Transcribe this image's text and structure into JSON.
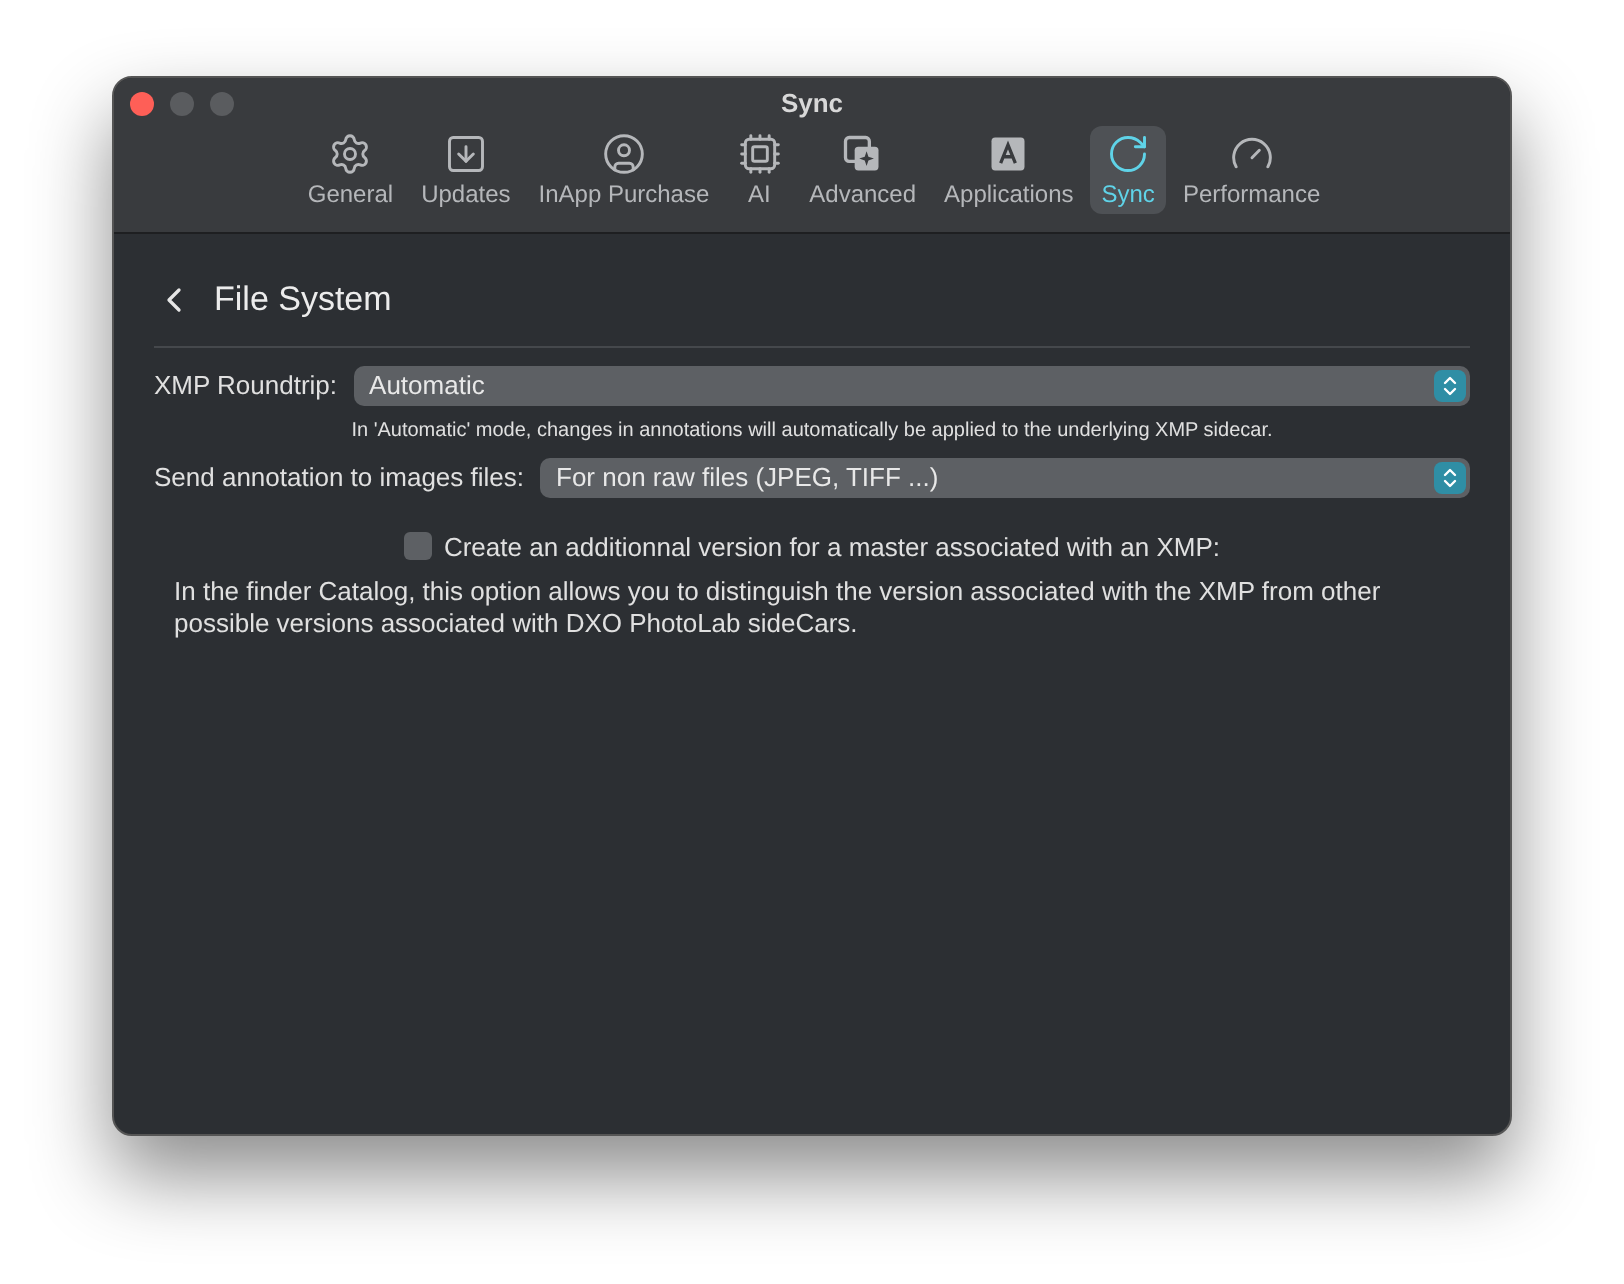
{
  "window": {
    "title": "Sync"
  },
  "tabs": [
    {
      "label": "General",
      "kind": "gear",
      "selected": false
    },
    {
      "label": "Updates",
      "kind": "download",
      "selected": false
    },
    {
      "label": "InApp Purchase",
      "kind": "user",
      "selected": false
    },
    {
      "label": "AI",
      "kind": "chip",
      "selected": false
    },
    {
      "label": "Advanced",
      "kind": "sparkle",
      "selected": false
    },
    {
      "label": "Applications",
      "kind": "letter",
      "selected": false
    },
    {
      "label": "Sync",
      "kind": "sync",
      "selected": true
    },
    {
      "label": "Performance",
      "kind": "gauge",
      "selected": false
    }
  ],
  "header": {
    "title": "File System"
  },
  "xmp_roundtrip": {
    "label": "XMP Roundtrip:",
    "value": "Automatic",
    "hint": "In 'Automatic' mode, changes in annotations will automatically be applied to the underlying XMP sidecar."
  },
  "send_annotation": {
    "label": "Send annotation to images files:",
    "value": "For non raw files (JPEG, TIFF ...)"
  },
  "additional_version": {
    "label": "Create an additionnal version for a master associated with an XMP:",
    "checked": false,
    "description": "In the finder Catalog, this option allows you to distinguish the version associated with the XMP from other possible versions associated with DXO PhotoLab sideCars."
  }
}
